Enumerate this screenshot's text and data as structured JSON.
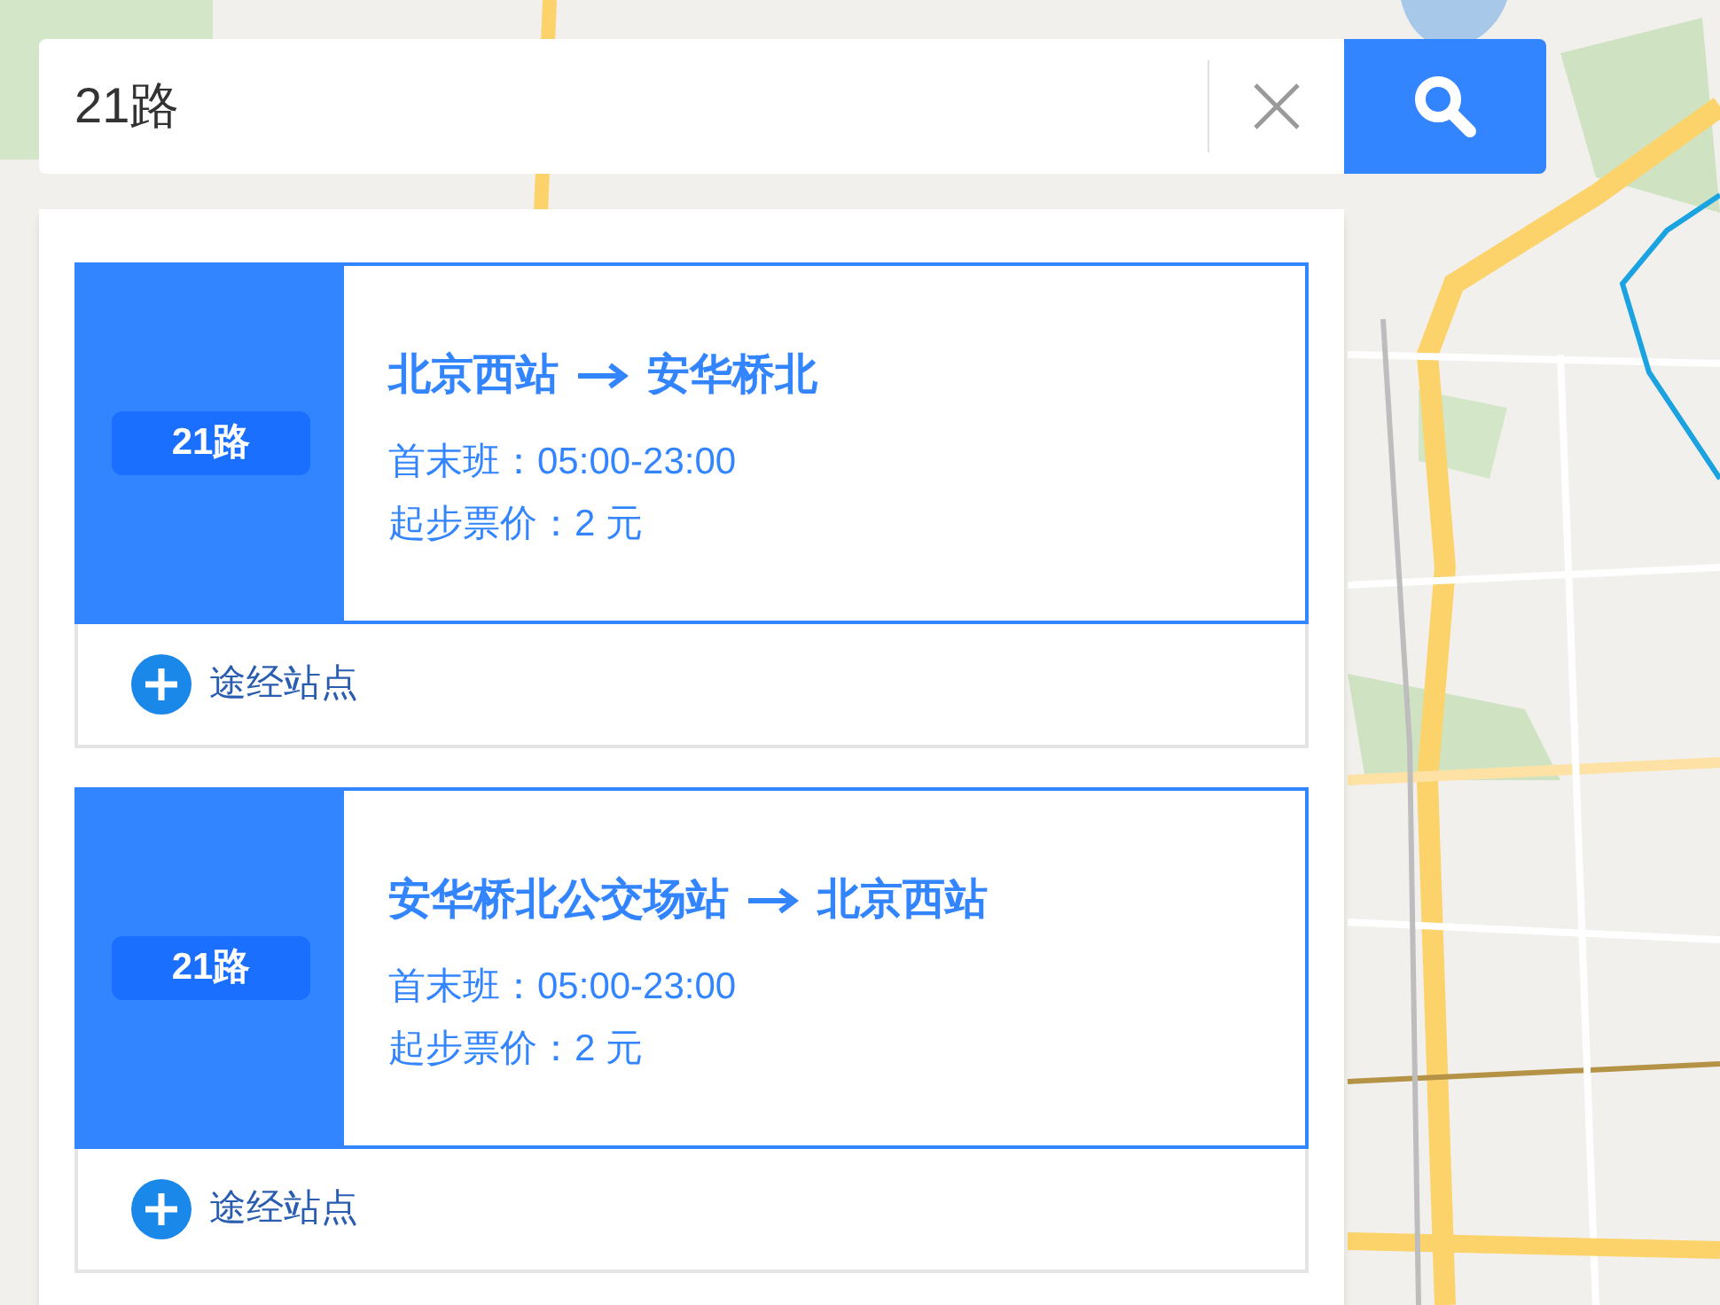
{
  "search": {
    "value": "21路"
  },
  "routes": [
    {
      "badge": "21路",
      "from": "北京西站",
      "to": "安华桥北",
      "hours": "首末班：05:00-23:00",
      "fare": "起步票价：2 元",
      "stops_label": "途经站点"
    },
    {
      "badge": "21路",
      "from": "安华桥北公交场站",
      "to": "北京西站",
      "hours": "首末班：05:00-23:00",
      "fare": "起步票价：2 元",
      "stops_label": "途经站点"
    }
  ]
}
